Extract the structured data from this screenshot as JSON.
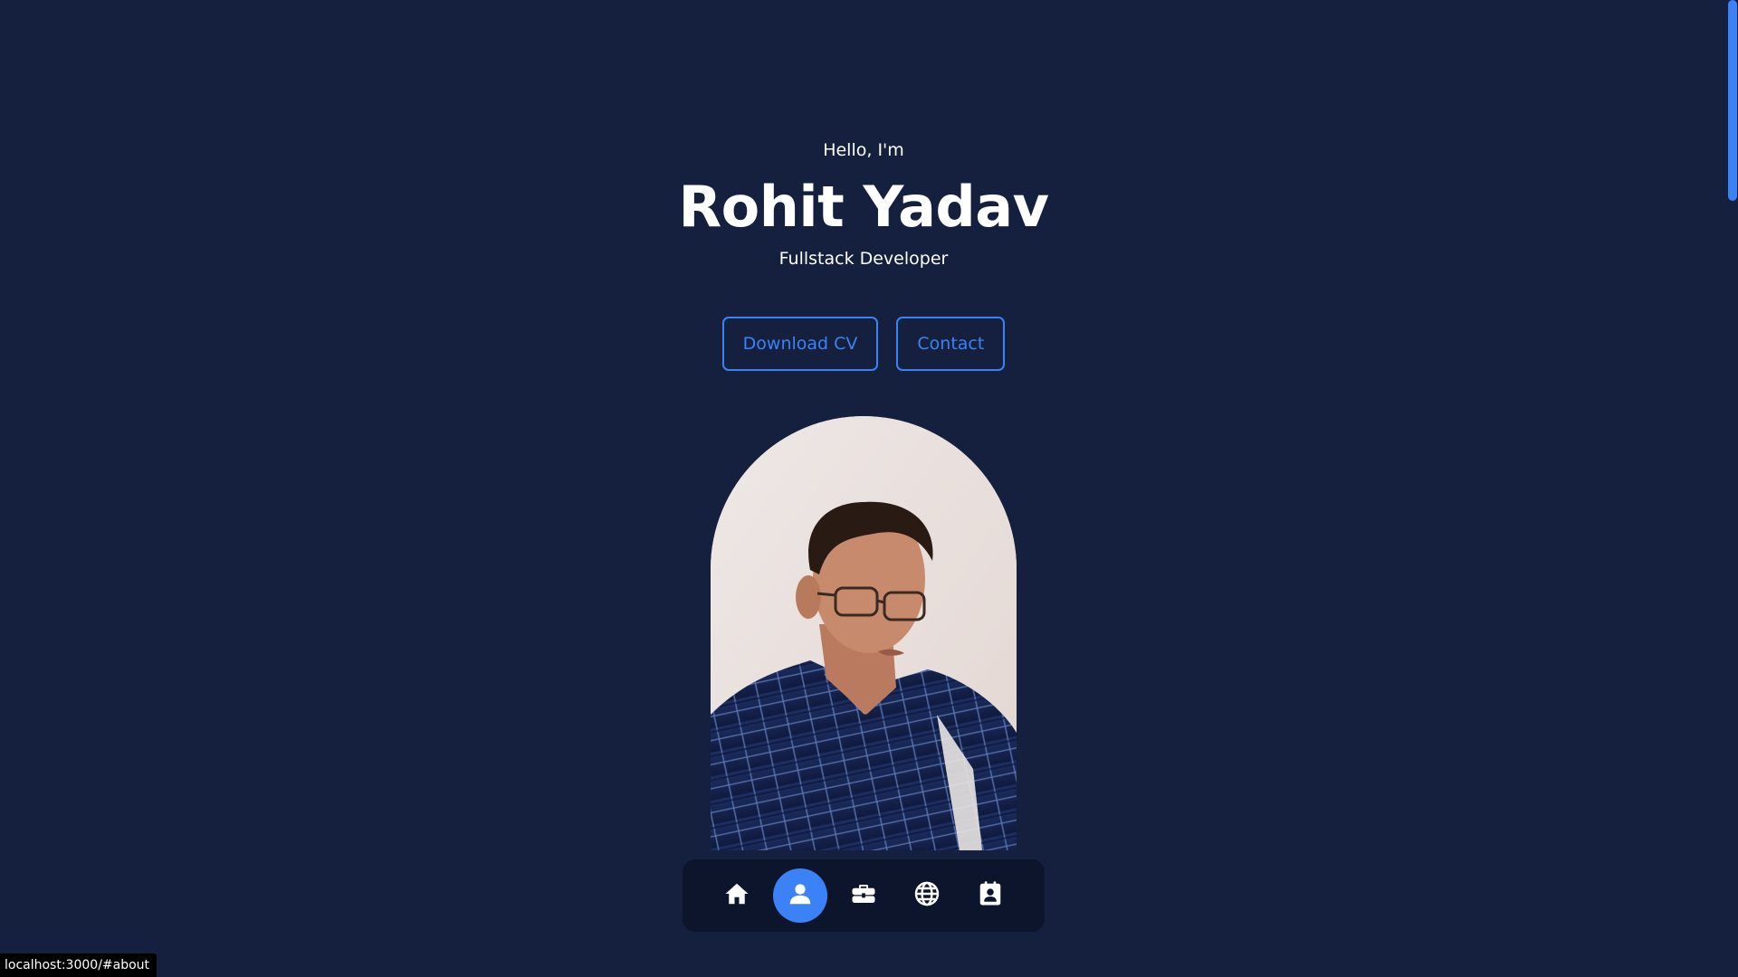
{
  "hero": {
    "greeting": "Hello, I'm",
    "name": "Rohit Yadav",
    "role": "Fullstack Developer"
  },
  "buttons": {
    "download_cv": "Download CV",
    "contact": "Contact"
  },
  "portrait": {
    "alt": "Portrait of Rohit Yadav"
  },
  "dock": {
    "items": [
      {
        "icon": "home-icon",
        "active": false
      },
      {
        "icon": "user-icon",
        "active": true
      },
      {
        "icon": "briefcase-icon",
        "active": false
      },
      {
        "icon": "globe-icon",
        "active": false
      },
      {
        "icon": "contact-card-icon",
        "active": false
      }
    ]
  },
  "status_bar": {
    "url": "localhost:3000/#about"
  },
  "colors": {
    "background": "#15203f",
    "accent": "#3b82f6",
    "dock_background": "#0d152c",
    "text": "#ffffff"
  }
}
